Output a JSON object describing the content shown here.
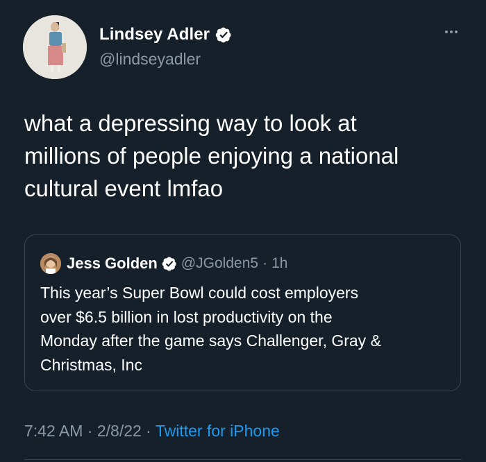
{
  "author": {
    "display_name": "Lindsey Adler",
    "handle": "@lindseyadler",
    "verified": true,
    "avatar_icon": "person-avatar"
  },
  "tweet": {
    "text_lines": [
      "what a depressing way to look at",
      "millions of people enjoying a national",
      "cultural event lmfao"
    ]
  },
  "quoted_tweet": {
    "display_name": "Jess Golden",
    "handle": "@JGolden5",
    "separator": "·",
    "time_ago": "1h",
    "verified": true,
    "text_lines": [
      "This year’s Super Bowl could cost employers",
      "over $6.5 billion in lost productivity on the",
      "Monday after the game says Challenger, Gray &",
      "Christmas, Inc"
    ]
  },
  "meta": {
    "time": "7:42 AM",
    "sep1": " · ",
    "date": "2/8/22",
    "sep2": " · ",
    "source": "Twitter for iPhone"
  },
  "colors": {
    "background": "#15202b",
    "secondary_text": "#8b98a5",
    "link": "#1d9bf0",
    "border": "#38444d"
  }
}
